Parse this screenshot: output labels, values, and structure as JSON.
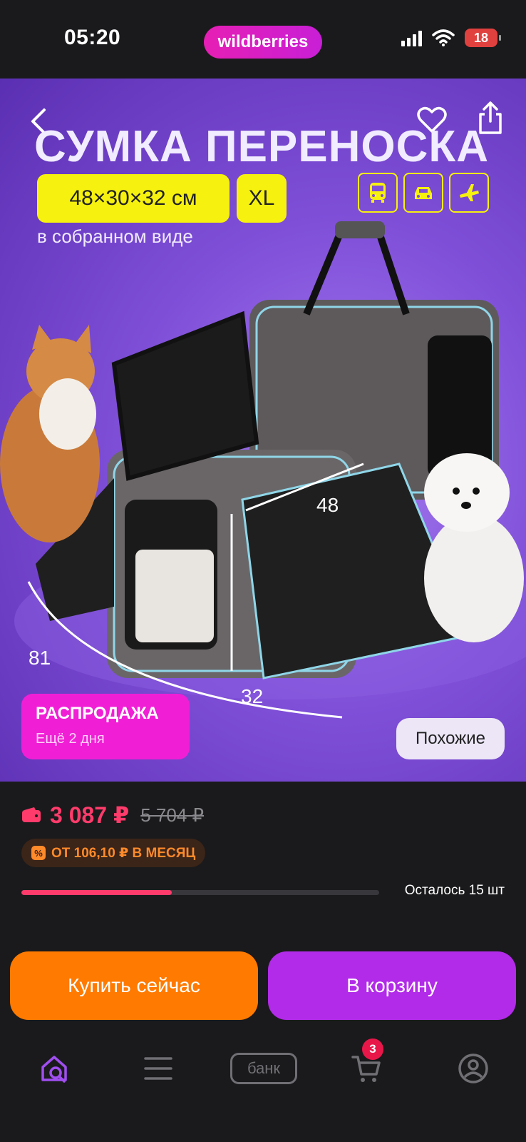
{
  "status_bar": {
    "time": "05:20",
    "brand": "wildberries",
    "battery": "18"
  },
  "product_image": {
    "headline": "СУМКА ПЕРЕНОСКА",
    "dimensions": "48×30×32 см",
    "size": "XL",
    "dimensions_note": "в собранном виде",
    "transport_icons": [
      "bus-icon",
      "car-icon",
      "plane-icon"
    ],
    "measure_length": "48",
    "measure_depth": "32",
    "measure_width": "81",
    "sale_title": "РАСПРОДАЖА",
    "sale_subtitle": "Ещё 2 дня",
    "similar_label": "Похожие"
  },
  "price": {
    "current": "3 087 ₽",
    "old": "5 704 ₽",
    "installment": "ОТ 106,10 ₽ В МЕСЯЦ",
    "stock_text": "Осталось 15 шт",
    "stock_fraction": 0.42
  },
  "actions": {
    "buy_now": "Купить сейчас",
    "add_to_cart": "В корзину"
  },
  "tabbar": {
    "bank_label": "банк",
    "cart_count": "3"
  },
  "colors": {
    "accent_pink": "#ff3b6b",
    "buy_orange": "#ff7a00",
    "cart_purple": "#b22be8",
    "sale_magenta": "#f01fd6",
    "badge_yellow": "#f6f10f"
  }
}
